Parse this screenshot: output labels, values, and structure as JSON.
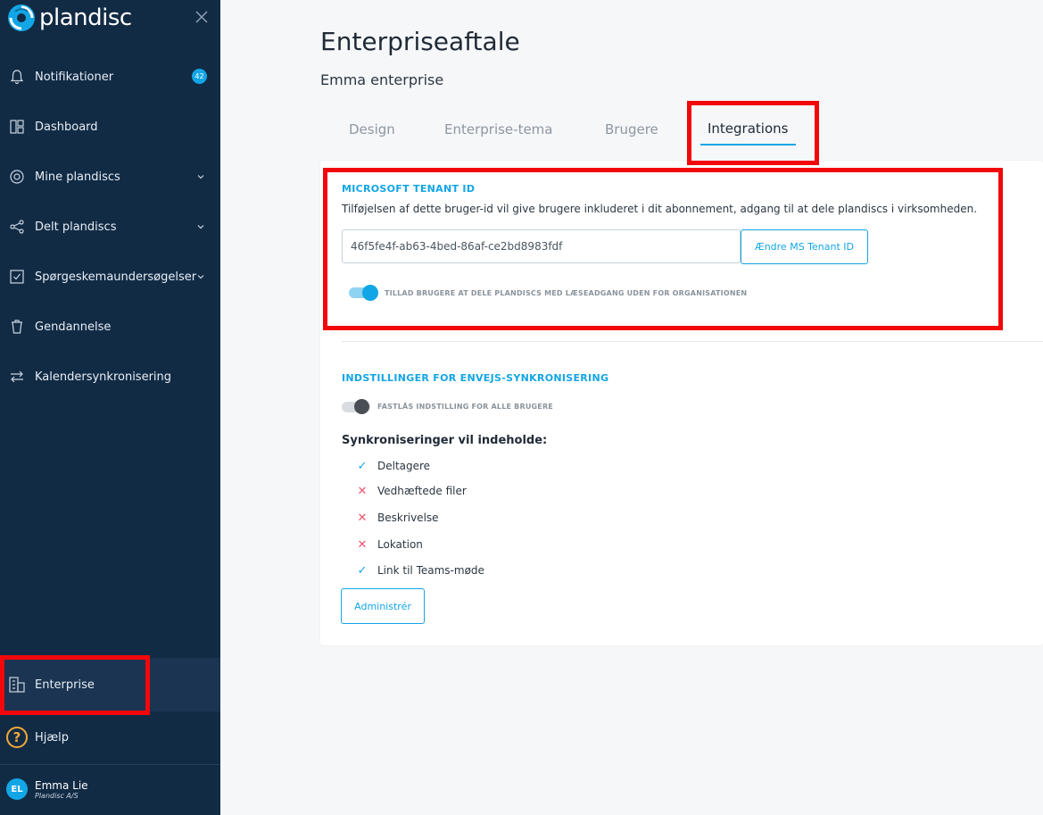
{
  "brand": {
    "name": "plandisc"
  },
  "sidebar": {
    "items": [
      {
        "label": "Notifikationer",
        "icon": "bell-icon",
        "badge": "42"
      },
      {
        "label": "Dashboard",
        "icon": "dashboard-icon"
      },
      {
        "label": "Mine plandiscs",
        "icon": "disc-icon"
      },
      {
        "label": "Delt plandiscs",
        "icon": "share-icon"
      },
      {
        "label": "Spørgeskemaundersøgelser",
        "icon": "checkbox-icon"
      },
      {
        "label": "Gendannelse",
        "icon": "trash-icon"
      },
      {
        "label": "Kalendersynkronisering",
        "icon": "sync-arrows-icon"
      }
    ],
    "enterprise": {
      "label": "Enterprise",
      "icon": "building-icon"
    },
    "help": {
      "label": "Hjælp",
      "icon": "question-icon",
      "glyph": "?"
    },
    "user": {
      "initials": "EL",
      "name": "Emma Lie",
      "org": "Plandisc A/S"
    }
  },
  "page": {
    "title": "Enterpriseaftale",
    "subtitle": "Emma enterprise"
  },
  "tabs": [
    {
      "label": "Design"
    },
    {
      "label": "Enterprise-tema"
    },
    {
      "label": "Brugere"
    },
    {
      "label": "Integrations",
      "active": true
    }
  ],
  "tenant": {
    "heading": "MICROSOFT TENANT ID",
    "description": "Tilføjelsen af dette bruger-id vil give brugere inkluderet i dit abonnement, adgang til at dele plandiscs i virksomheden.",
    "value": "46f5fe4f-ab63-4bed-86af-ce2bd8983fdf",
    "button_label": "Ændre MS Tenant ID",
    "toggle_label": "TILLAD BRUGERE AT DELE PLANDISCS MED LÆSEADGANG UDEN FOR ORGANISATIONEN",
    "toggle_on": true
  },
  "sync": {
    "heading": "INDSTILLINGER FOR ENVEJS-SYNKRONISERING",
    "lock_label": "FASTLÅS INDSTILLING FOR ALLE BRUGERE",
    "lock_on": false,
    "includes_heading": "Synkroniseringer vil indeholde:",
    "items": [
      {
        "label": "Deltagere",
        "included": true,
        "mark": "✓"
      },
      {
        "label": "Vedhæftede filer",
        "included": false,
        "mark": "✕"
      },
      {
        "label": "Beskrivelse",
        "included": false,
        "mark": "✕"
      },
      {
        "label": "Lokation",
        "included": false,
        "mark": "✕"
      },
      {
        "label": "Link til Teams-møde",
        "included": true,
        "mark": "✓"
      }
    ],
    "manage_label": "Administrér"
  },
  "colors": {
    "sidebar_bg": "#122b45",
    "accent": "#12a6e6",
    "error": "#e8556f",
    "annotation": "#f2070b"
  }
}
